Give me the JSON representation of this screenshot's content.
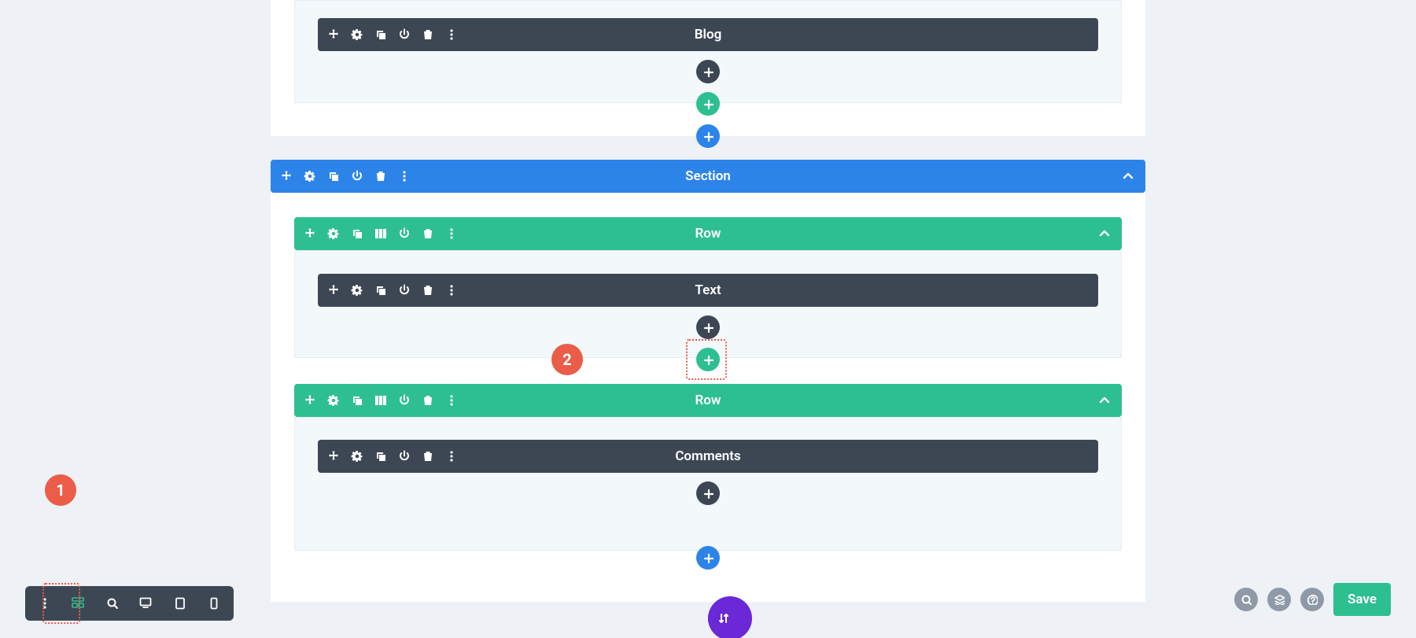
{
  "modules": {
    "blog": {
      "label": "Blog"
    },
    "text": {
      "label": "Text"
    },
    "comments": {
      "label": "Comments"
    }
  },
  "section": {
    "label": "Section"
  },
  "rows": {
    "row1": {
      "label": "Row"
    },
    "row2": {
      "label": "Row"
    }
  },
  "footer": {
    "save": "Save"
  },
  "annotations": {
    "badge1": "1",
    "badge2": "2"
  },
  "colors": {
    "module": "#3d4754",
    "section": "#2c84e9",
    "row": "#2ebf91",
    "purple": "#6b28d6",
    "annotation": "#eb5c49",
    "page_bg": "#eef1f6"
  }
}
